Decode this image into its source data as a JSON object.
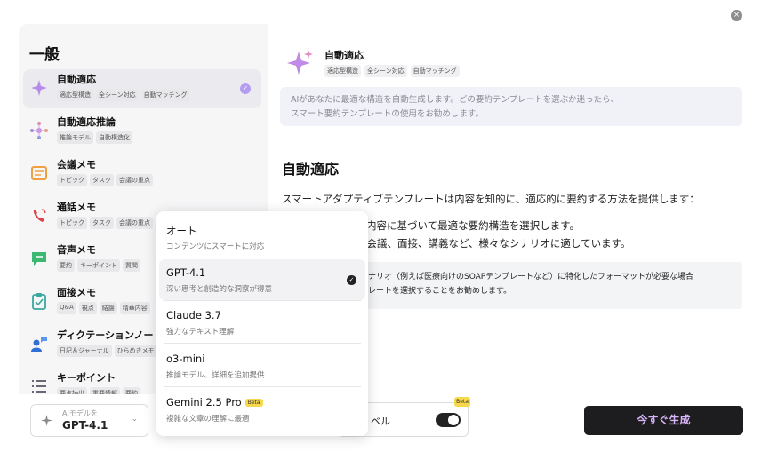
{
  "close": "×",
  "left": {
    "title": "一般",
    "templates": [
      {
        "name": "自動適応",
        "tags": [
          "適応型構造",
          "全シーン対応",
          "自動マッチング"
        ],
        "selected": true,
        "icon": "sparkle-icon"
      },
      {
        "name": "自動適応推論",
        "tags": [
          "推論モデル",
          "自動構造化"
        ],
        "icon": "reasoning-icon"
      },
      {
        "name": "会議メモ",
        "tags": [
          "トピック",
          "タスク",
          "会議の重点"
        ],
        "icon": "meeting-icon"
      },
      {
        "name": "通話メモ",
        "tags": [
          "トピック",
          "タスク",
          "会議の重点"
        ],
        "icon": "phone-icon"
      },
      {
        "name": "音声メモ",
        "tags": [
          "要約",
          "キーポイント",
          "質問"
        ],
        "icon": "voice-memo-icon"
      },
      {
        "name": "面接メモ",
        "tags": [
          "Q&A",
          "視点",
          "結論",
          "精華内容"
        ],
        "icon": "clipboard-icon"
      },
      {
        "name": "ディクテーションノート",
        "tags": [
          "日記＆ジャーナル",
          "ひらめきメモ"
        ],
        "icon": "dictation-icon"
      },
      {
        "name": "キーポイント",
        "tags": [
          "要点抽出",
          "重要情報",
          "要約"
        ],
        "icon": "list-icon"
      }
    ]
  },
  "detail": {
    "name": "自動適応",
    "tags": [
      "適応型構造",
      "全シーン対応",
      "自動マッチング"
    ],
    "desc_line1": "AIがあなたに最適な構造を自動生成します。どの要約テンプレートを選ぶか迷ったら、",
    "desc_line2": "スマート要約テンプレートの使用をお勧めします。",
    "section_title": "自動適応",
    "section_body": "スマートアダプティブテンプレートは内容を知的に、適応的に要約する方法を提供します：",
    "bullet1": "内容に基づいて最適な要約構造を選択します。",
    "bullet2": "：会議、面接、講義など、様々なシナリオに適しています。",
    "note1": "ナリオ（例えば医療向けのSOAPテンプレートなど）に特化したフォーマットが必要な場合",
    "note2": "レートを選択することをお勧めします。"
  },
  "bottom": {
    "model_label": "AIモデルを",
    "model_value": "GPT-4.1",
    "level_label": "ベル",
    "beta": "Beta",
    "generate": "今すぐ生成"
  },
  "dropdown": {
    "options": [
      {
        "name": "オート",
        "desc": "コンテンツにスマートに対応"
      },
      {
        "name": "GPT-4.1",
        "desc": "深い思考と創造的な洞察が得意",
        "selected": true
      },
      {
        "name": "Claude 3.7",
        "desc": "強力なテキスト理解"
      },
      {
        "name": "o3-mini",
        "desc": "推論モデル、詳細を追加提供"
      },
      {
        "name": "Gemini 2.5 Pro",
        "desc": "複雑な文章の理解に最適",
        "beta": "Beta"
      }
    ]
  },
  "colors": {
    "accent": "#b49cf0",
    "generate_text": "#d8b4f8",
    "beta": "#f7d84a"
  }
}
